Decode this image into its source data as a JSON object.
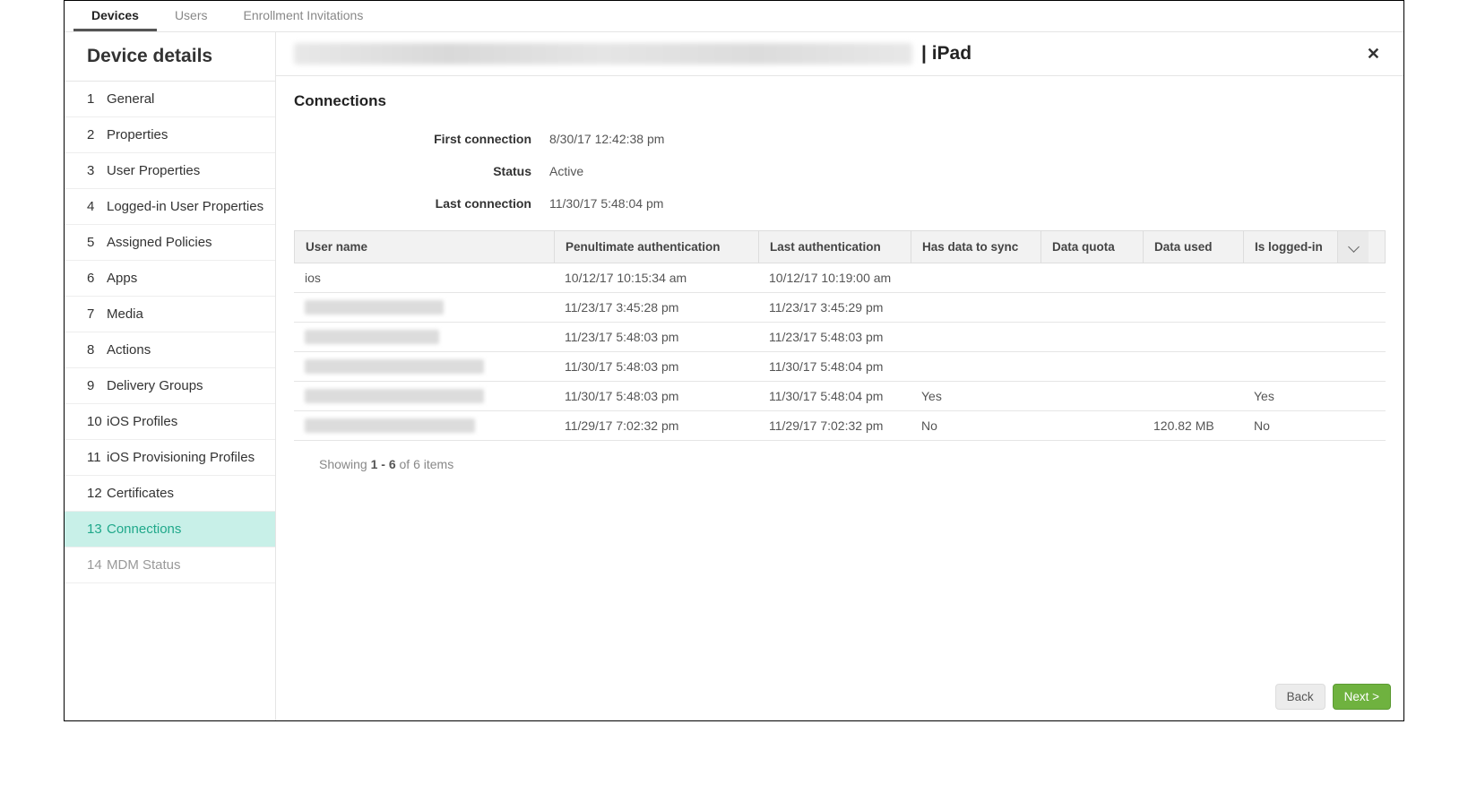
{
  "top_tabs": {
    "devices": "Devices",
    "users": "Users",
    "enroll": "Enrollment Invitations"
  },
  "sidebar": {
    "title": "Device details",
    "items": [
      {
        "num": "1",
        "label": "General"
      },
      {
        "num": "2",
        "label": "Properties"
      },
      {
        "num": "3",
        "label": "User Properties"
      },
      {
        "num": "4",
        "label": "Logged-in User Properties"
      },
      {
        "num": "5",
        "label": "Assigned Policies"
      },
      {
        "num": "6",
        "label": "Apps"
      },
      {
        "num": "7",
        "label": "Media"
      },
      {
        "num": "8",
        "label": "Actions"
      },
      {
        "num": "9",
        "label": "Delivery Groups"
      },
      {
        "num": "10",
        "label": "iOS Profiles"
      },
      {
        "num": "11",
        "label": "iOS Provisioning Profiles"
      },
      {
        "num": "12",
        "label": "Certificates"
      },
      {
        "num": "13",
        "label": "Connections"
      },
      {
        "num": "14",
        "label": "MDM Status"
      }
    ]
  },
  "header": {
    "suffix": "| iPad"
  },
  "section": {
    "title": "Connections",
    "kv": [
      {
        "label": "First connection",
        "value": "8/30/17 12:42:38 pm"
      },
      {
        "label": "Status",
        "value": "Active"
      },
      {
        "label": "Last connection",
        "value": "11/30/17 5:48:04 pm"
      }
    ]
  },
  "table": {
    "headers": {
      "user": "User name",
      "pen": "Penultimate authentication",
      "last": "Last authentication",
      "sync": "Has data to sync",
      "quota": "Data quota",
      "used": "Data used",
      "log": "Is logged-in"
    },
    "rows": [
      {
        "user": "ios",
        "pen": "10/12/17 10:15:34 am",
        "last": "10/12/17 10:19:00 am",
        "sync": "",
        "quota": "",
        "used": "",
        "log": ""
      },
      {
        "user": "",
        "pen": "11/23/17 3:45:28 pm",
        "last": "11/23/17 3:45:29 pm",
        "sync": "",
        "quota": "",
        "used": "",
        "log": ""
      },
      {
        "user": "",
        "pen": "11/23/17 5:48:03 pm",
        "last": "11/23/17 5:48:03 pm",
        "sync": "",
        "quota": "",
        "used": "",
        "log": ""
      },
      {
        "user": "",
        "pen": "11/30/17 5:48:03 pm",
        "last": "11/30/17 5:48:04 pm",
        "sync": "",
        "quota": "",
        "used": "",
        "log": ""
      },
      {
        "user": "",
        "pen": "11/30/17 5:48:03 pm",
        "last": "11/30/17 5:48:04 pm",
        "sync": "Yes",
        "quota": "",
        "used": "",
        "log": "Yes"
      },
      {
        "user": "",
        "pen": "11/29/17 7:02:32 pm",
        "last": "11/29/17 7:02:32 pm",
        "sync": "No",
        "quota": "",
        "used": "120.82 MB",
        "log": "No"
      }
    ]
  },
  "pager": {
    "prefix": "Showing ",
    "range": "1 - 6",
    "suffix": " of 6 items"
  },
  "footer": {
    "back": "Back",
    "next": "Next >"
  },
  "blur_widths": [
    155,
    150,
    200,
    200,
    190
  ]
}
